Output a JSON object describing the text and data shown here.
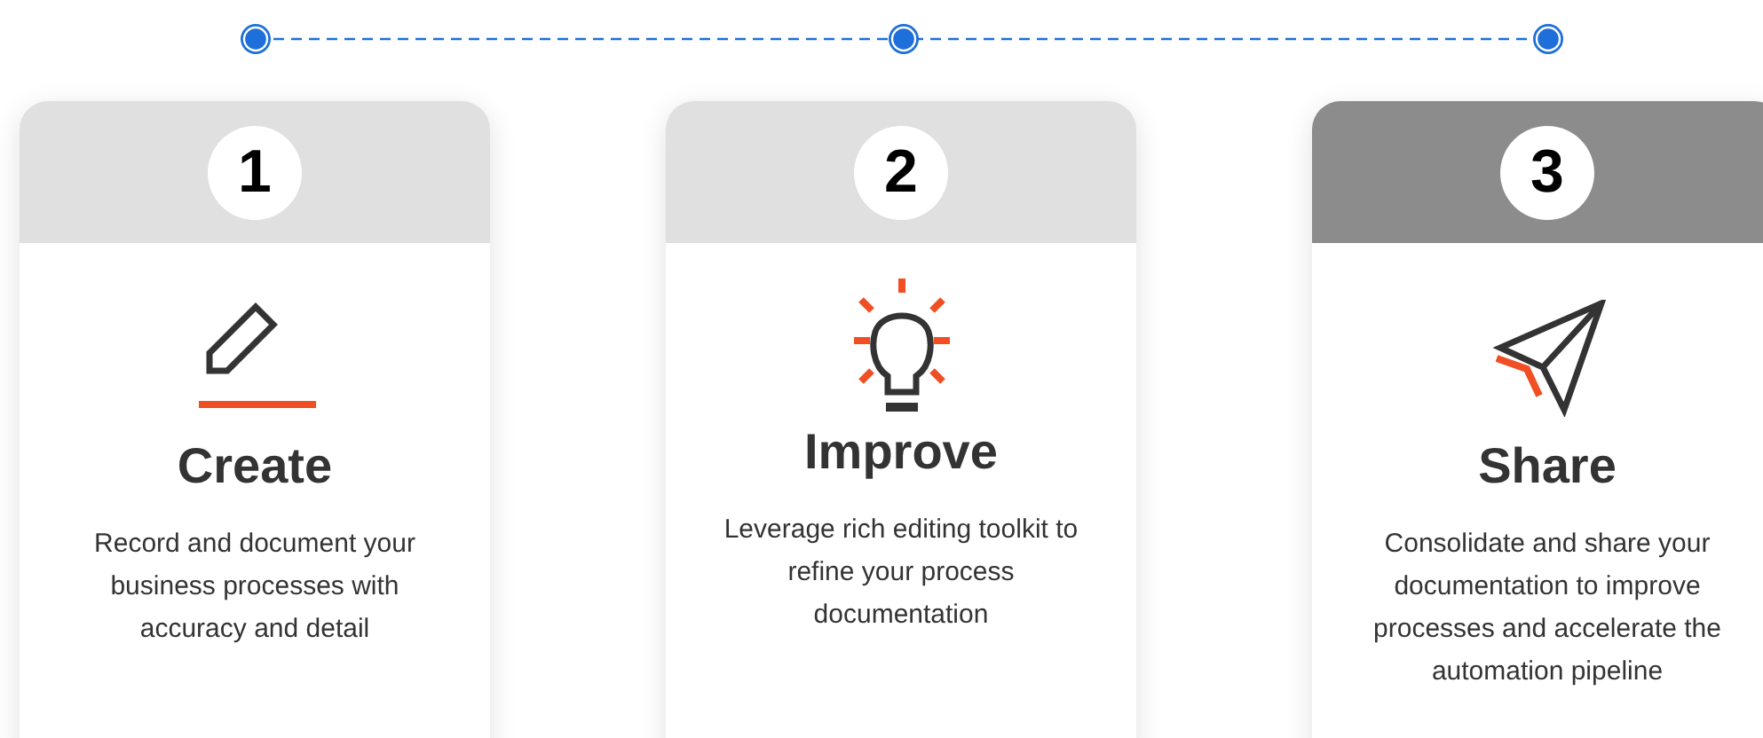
{
  "steps": [
    {
      "number": "1",
      "title": "Create",
      "description": "Record and document your business processes with accuracy and detail",
      "selected": false
    },
    {
      "number": "2",
      "title": "Improve",
      "description": "Leverage rich editing toolkit to refine your process documentation",
      "selected": false
    },
    {
      "number": "3",
      "title": "Share",
      "description": "Consolidate and share your documentation to improve processes and accelerate the automation pipeline",
      "selected": true
    }
  ]
}
